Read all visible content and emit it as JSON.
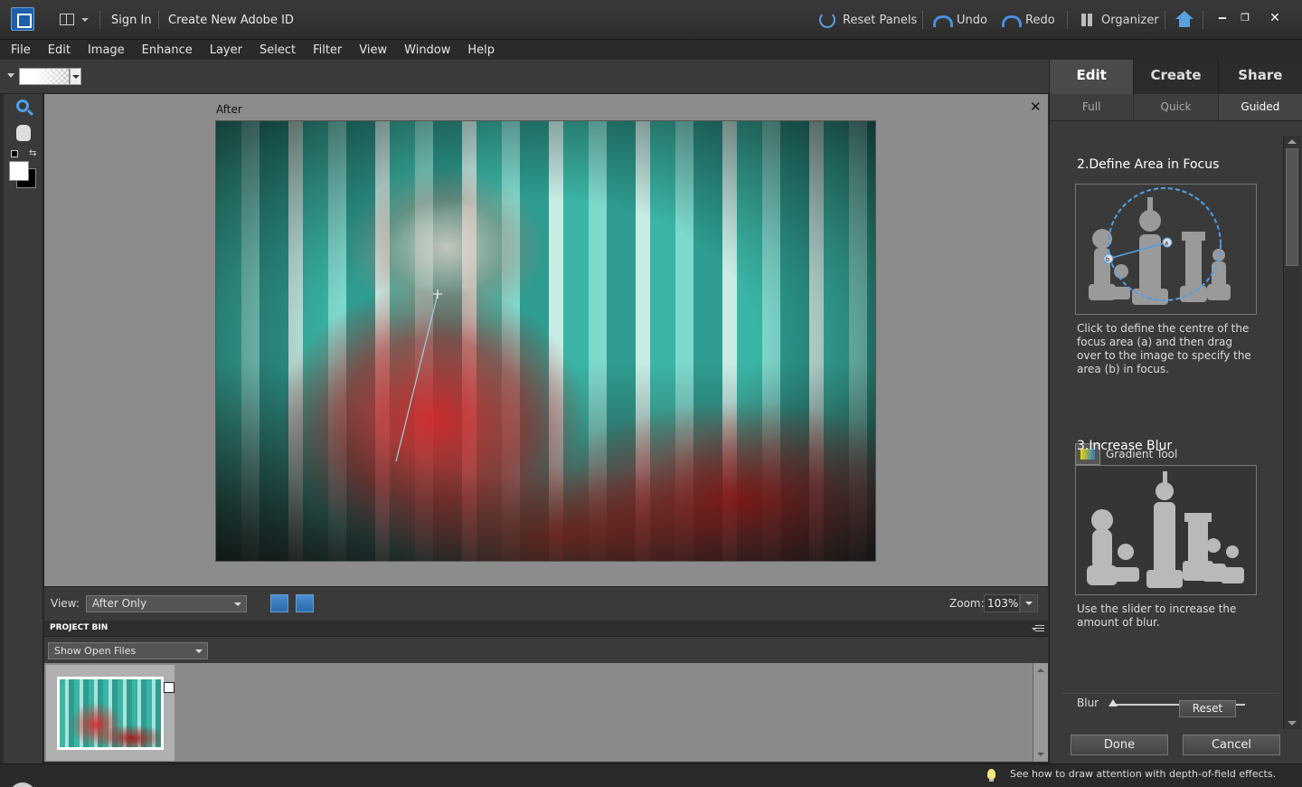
{
  "titlebar": {
    "sign_in": "Sign In",
    "create_id": "Create New Adobe ID",
    "reset_panels": "Reset Panels",
    "undo": "Undo",
    "redo": "Redo",
    "organizer": "Organizer",
    "minimize": "‒",
    "restore": "❐",
    "close": "✕"
  },
  "menu": [
    "File",
    "Edit",
    "Image",
    "Enhance",
    "Layer",
    "Select",
    "Filter",
    "View",
    "Window",
    "Help"
  ],
  "canvas": {
    "label": "After",
    "close": "✕"
  },
  "viewbar": {
    "view_label": "View:",
    "view_value": "After Only",
    "zoom_label": "Zoom:",
    "zoom_value": "103%"
  },
  "project_bin": {
    "title": "PROJECT BIN",
    "filter_value": "Show Open Files"
  },
  "panel": {
    "tabs": [
      "Edit",
      "Create",
      "Share"
    ],
    "subtabs": [
      "Full",
      "Quick",
      "Guided"
    ],
    "step2_title": "2.Define Area in Focus",
    "step2_desc": "Click to define the centre of the focus area (a) and then drag over to the image to specify the area (b) in focus.",
    "gradient_tool": "Gradient Tool",
    "step3_title": "3.Increase Blur",
    "step3_desc": "Use the slider to increase the amount of blur.",
    "blur_label": "Blur",
    "blur_level": 0,
    "reset": "Reset",
    "done": "Done",
    "cancel": "Cancel",
    "diagram_labels": {
      "a": "a",
      "b": "b"
    }
  },
  "status": {
    "tip": "See how to draw attention with depth-of-field effects."
  },
  "colors": {
    "accent": "#4fa0e8",
    "foreground": "#ffffff",
    "background": "#000000"
  },
  "icons": [
    "app-logo-icon",
    "workspace-icon",
    "reset-panels-icon",
    "undo-icon",
    "redo-icon",
    "organizer-icon",
    "home-icon",
    "zoom-tool-icon",
    "hand-tool-icon",
    "gradient-tool-icon",
    "bulb-icon"
  ]
}
